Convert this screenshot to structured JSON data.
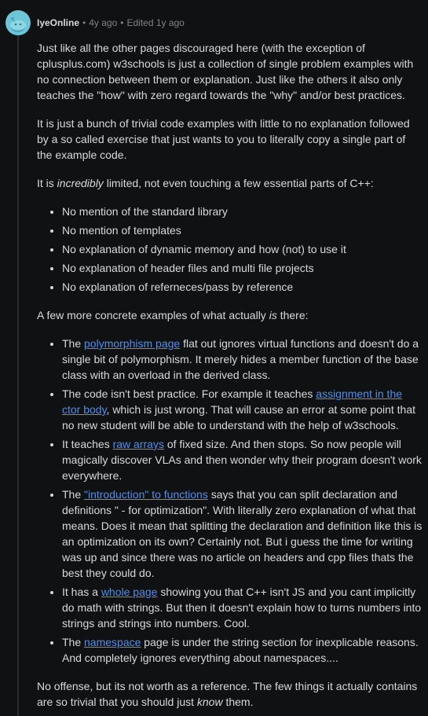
{
  "comment": {
    "username": "IyeOnline",
    "time": "4y ago",
    "edited": "Edited 1y ago",
    "separator": "•",
    "p1": "Just like all the other pages discouraged here (with the exception of cplusplus.com) w3schools is just a collection of single problem examples with no connection between them or explanation. Just like the others it also only teaches the \"how\" with zero regard towards the \"why\" and/or best practices.",
    "p2": "It is just a bunch of trivial code examples with little to no explanation followed by a so called exercise that just wants to you to literally copy a single part of the example code.",
    "p3": {
      "pre": "It is ",
      "em": "incredibly",
      "post": " limited, not even touching a few essential parts of C++:"
    },
    "list1": [
      "No mention of the standard library",
      "No mention of templates",
      "No explanation of dynamic memory and how (not) to use it",
      "No explanation of header files and multi file projects",
      "No explanation of referneces/pass by reference"
    ],
    "p4": {
      "pre": "A few more concrete examples of what actually ",
      "em": "is",
      "post": " there:"
    },
    "list2": [
      {
        "pre": "The ",
        "link": "polymorphism page",
        "post": " flat out ignores virtual functions and doesn't do a single bit of polymorphism. It merely hides a member function of the base class with an overload in the derived class."
      },
      {
        "pre": "The code isn't best practice. For example it teaches ",
        "link": "assignment in the ctor body",
        "post": ", which is just wrong. That will cause an error at some point that no new student will be able to understand with the help of w3schools."
      },
      {
        "pre": "It teaches ",
        "link": "raw arrays",
        "post": " of fixed size. And then stops. So now people will magically discover VLAs and then wonder why their program doesn't work everywhere."
      },
      {
        "pre": "The ",
        "link": "\"introduction\" to functions",
        "post": " says that you can split declaration and definitions \" - for optimization\". With literally zero explanation of what that means. Does it mean that splitting the declaration and definition like this is an optimization on its own? Certainly not. But i guess the time for writing was up and since there was no article on headers and cpp files thats the best they could do."
      },
      {
        "pre": "It has a ",
        "link": "whole page",
        "post": " showing you that C++ isn't JS and you cant implicitly do math with strings. But then it doesn't explain how to turns numbers into strings and strings into numbers. Cool."
      },
      {
        "pre": "The ",
        "link": "namespace",
        "post": " page is under the string section for inexplicable reasons. And completely ignores everything about namespaces...."
      }
    ],
    "p5": {
      "pre": "No offense, but its not worth as a reference. The few things it actually contains are so trivial that you should just ",
      "em": "know",
      "post": " them."
    }
  },
  "colors": {
    "background": "#0f1113",
    "text": "#d7dadc",
    "meta": "#818384",
    "link": "#4f8ef5",
    "avatar": "#6dc5d7"
  }
}
